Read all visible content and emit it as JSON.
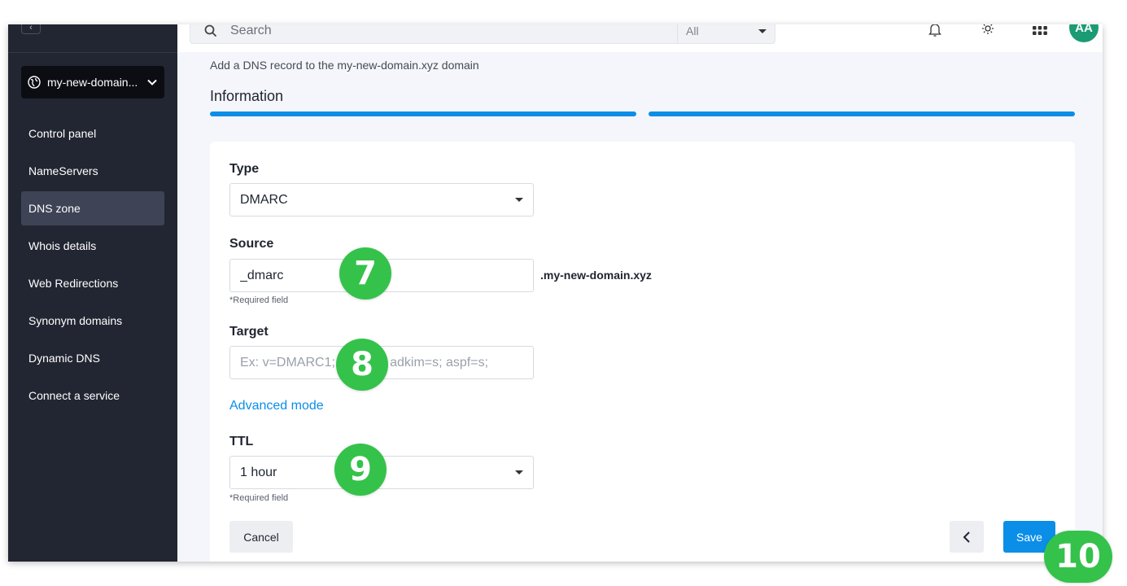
{
  "sidebar": {
    "collapse_glyph": "‹",
    "domain": "my-new-domain...",
    "items": [
      {
        "label": "Control panel",
        "active": false
      },
      {
        "label": "NameServers",
        "active": false
      },
      {
        "label": "DNS zone",
        "active": true
      },
      {
        "label": "Whois details",
        "active": false
      },
      {
        "label": "Web Redirections",
        "active": false
      },
      {
        "label": "Synonym domains",
        "active": false
      },
      {
        "label": "Dynamic DNS",
        "active": false
      },
      {
        "label": "Connect a service",
        "active": false
      }
    ]
  },
  "topbar": {
    "search_placeholder": "Search",
    "scope": "All",
    "avatar_initials": "AA",
    "icons": [
      "bell-icon",
      "gear-icon",
      "apps-grid-icon"
    ]
  },
  "page": {
    "subtitle": "Add a DNS record to the my-new-domain.xyz domain",
    "section_title": "Information",
    "steps_total": 2,
    "steps_completed": 2
  },
  "form": {
    "type": {
      "label": "Type",
      "value": "DMARC"
    },
    "source": {
      "label": "Source",
      "value": "_dmarc",
      "suffix": ".my-new-domain.xyz",
      "helper": "*Required field"
    },
    "target": {
      "label": "Target",
      "placeholder": "Ex: v=DMARC1; p=none; adkim=s; aspf=s;"
    },
    "advanced_link": "Advanced mode",
    "ttl": {
      "label": "TTL",
      "value": "1 hour",
      "helper": "*Required field"
    }
  },
  "actions": {
    "cancel": "Cancel",
    "save": "Save"
  },
  "badges": {
    "source": "7",
    "target": "8",
    "ttl": "9",
    "save": "10"
  },
  "colors": {
    "sidebar_bg": "#222632",
    "accent": "#0a8ee8",
    "badge": "#35c24b",
    "avatar": "#1a9b74"
  }
}
